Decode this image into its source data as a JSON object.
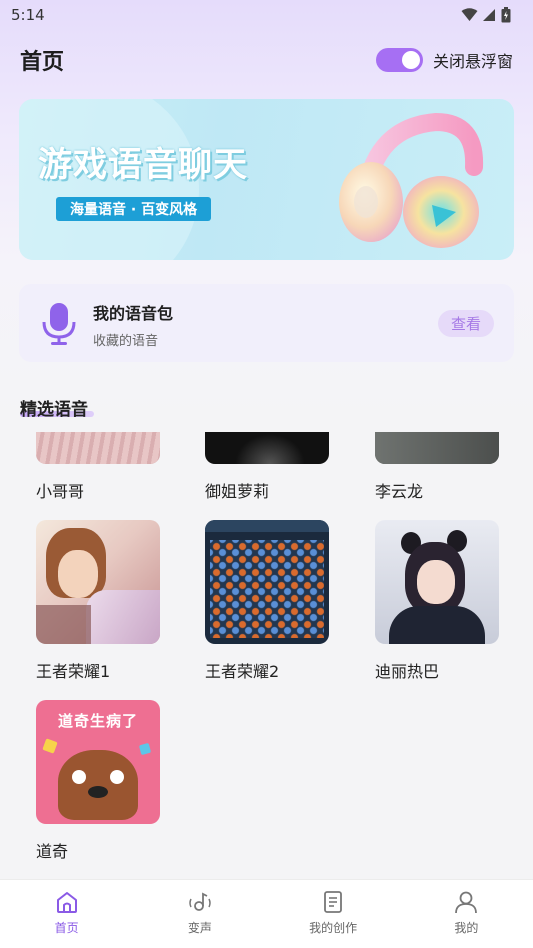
{
  "status_bar": {
    "time": "5:14"
  },
  "header": {
    "title": "首页",
    "toggle_label": "关闭悬浮窗",
    "toggle_on": true
  },
  "banner": {
    "title": "游戏语音聊天",
    "tag": "海量语音 · 百变风格"
  },
  "voice_pack": {
    "title": "我的语音包",
    "subtitle": "收藏的语音",
    "button": "查看"
  },
  "section": {
    "title": "精选语音"
  },
  "voices": [
    {
      "label": "小哥哥",
      "thumb": "photo-pink"
    },
    {
      "label": "御姐萝莉",
      "thumb": "photo-dark"
    },
    {
      "label": "李云龙",
      "thumb": "photo-grey"
    },
    {
      "label": "王者荣耀1",
      "thumb": "game-hero"
    },
    {
      "label": "王者荣耀2",
      "thumb": "game-inventory"
    },
    {
      "label": "迪丽热巴",
      "thumb": "portrait"
    },
    {
      "label": "道奇",
      "thumb": "cartoon-dog"
    }
  ],
  "dog_book_title": "道奇生病了",
  "tabs": [
    {
      "label": "首页",
      "icon": "home-icon",
      "active": true
    },
    {
      "label": "变声",
      "icon": "voice-change-icon",
      "active": false
    },
    {
      "label": "我的创作",
      "icon": "document-icon",
      "active": false
    },
    {
      "label": "我的",
      "icon": "user-icon",
      "active": false
    }
  ],
  "colors": {
    "accent": "#a66ff3",
    "tab_active": "#8a5ae6",
    "banner_tag": "#1d9fd6"
  }
}
